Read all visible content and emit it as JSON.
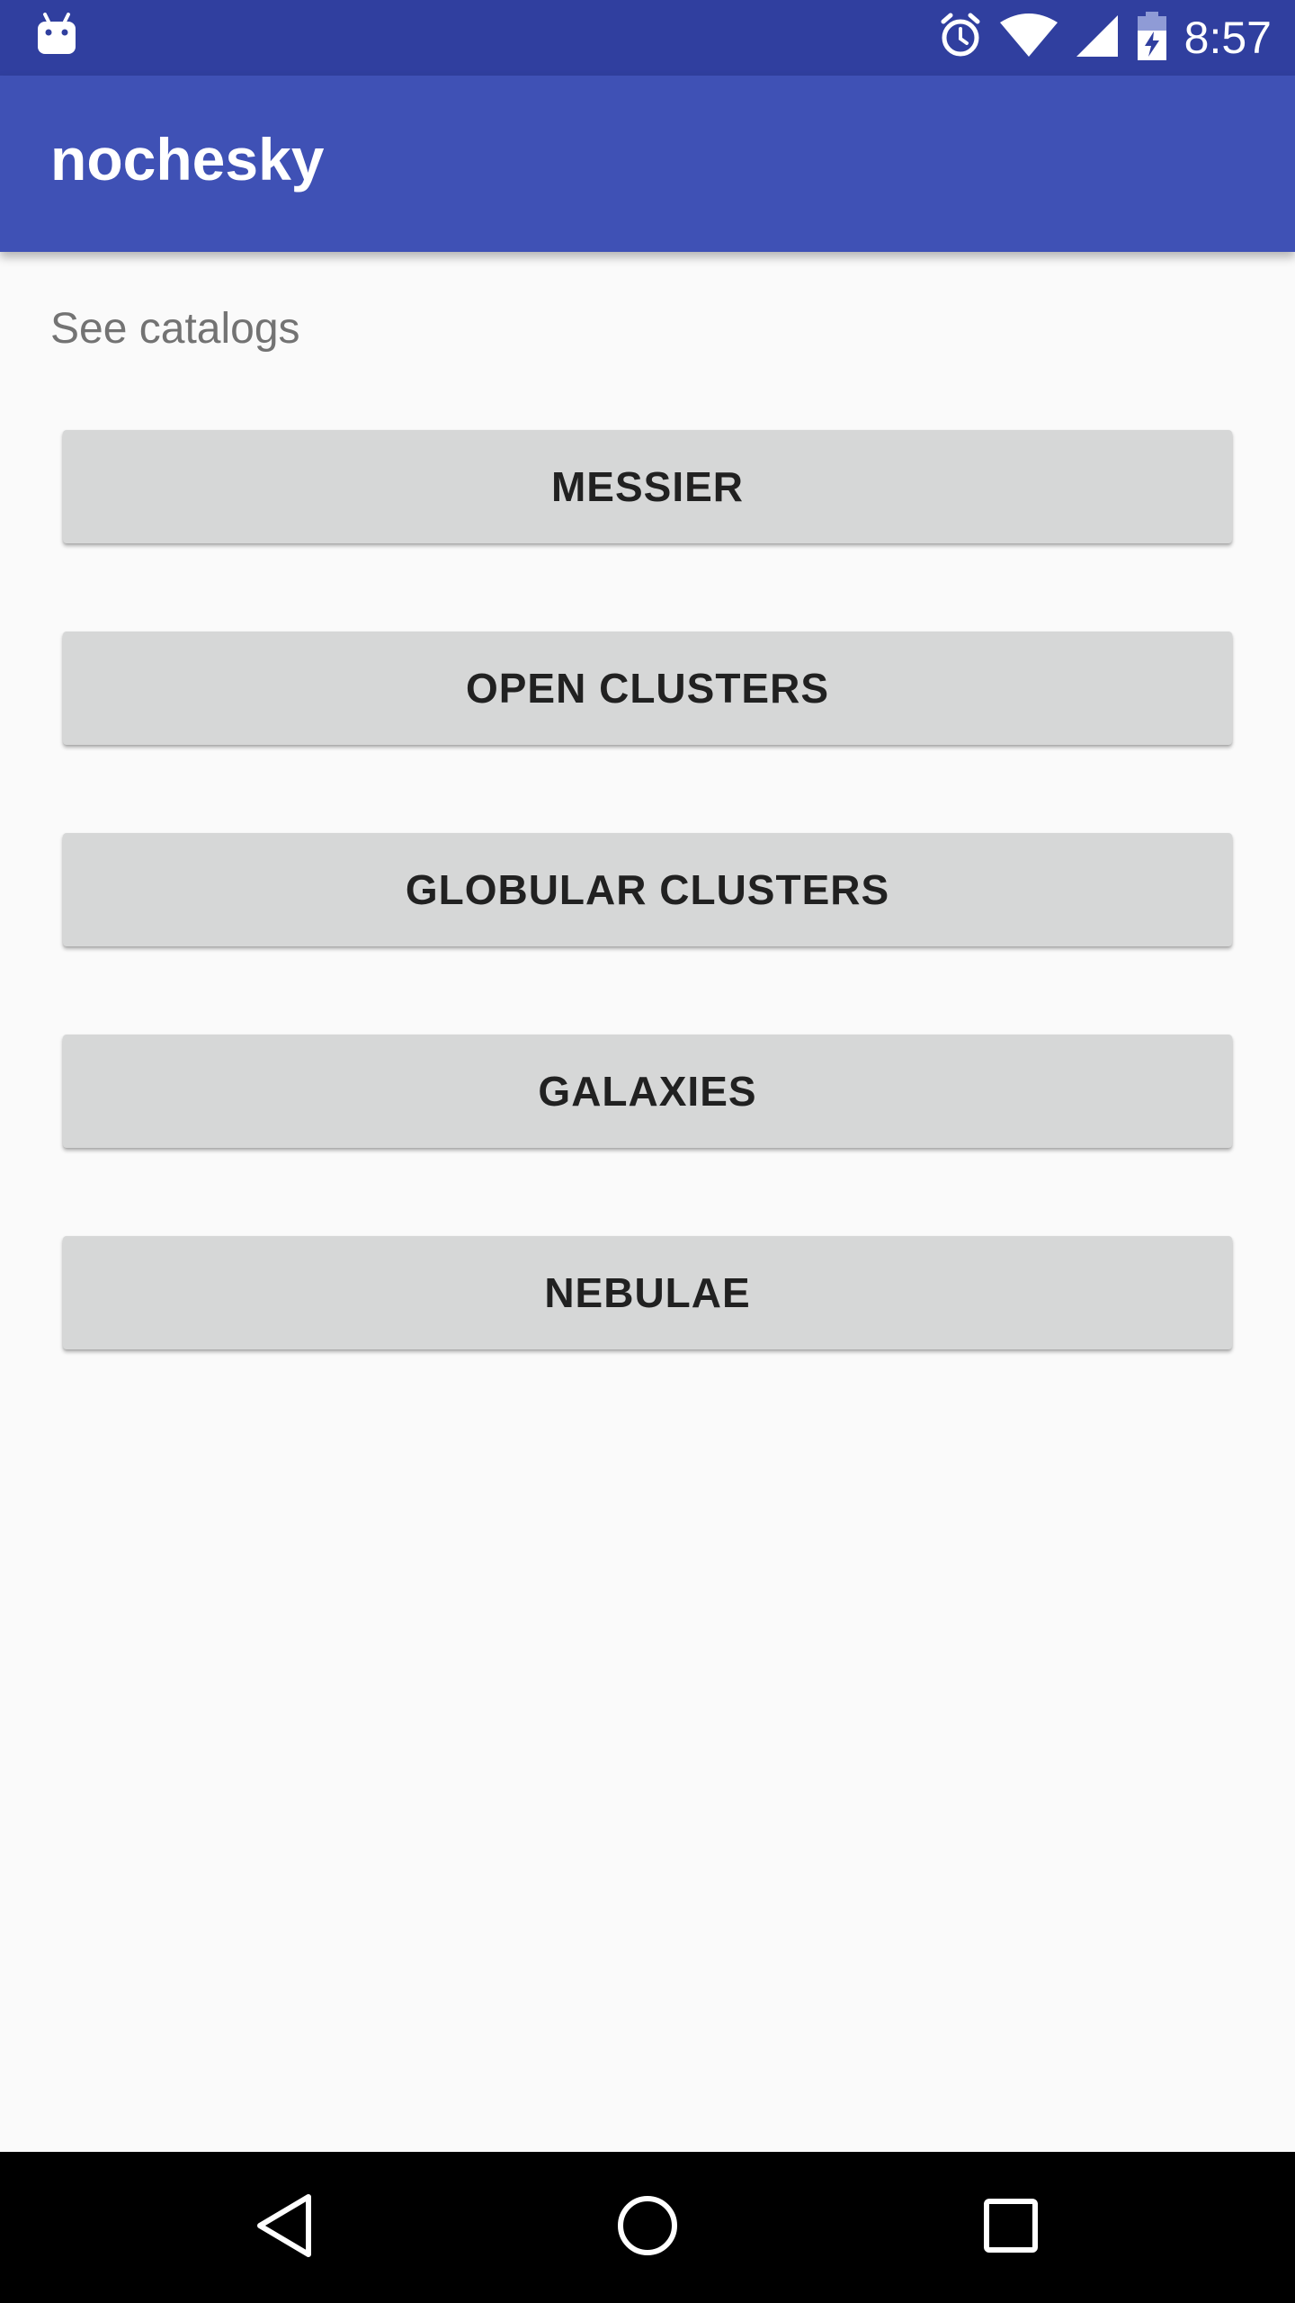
{
  "status_bar": {
    "time": "8:57",
    "icons": [
      "android-notification-icon",
      "alarm-icon",
      "wifi-icon",
      "cell-signal-icon",
      "battery-charging-icon"
    ],
    "background": "#303f9f"
  },
  "app_bar": {
    "title": "nochesky",
    "background": "#3f51b5"
  },
  "main": {
    "section_label": "See catalogs",
    "buttons": [
      {
        "label": "MESSIER"
      },
      {
        "label": "OPEN CLUSTERS"
      },
      {
        "label": "GLOBULAR CLUSTERS"
      },
      {
        "label": "GALAXIES"
      },
      {
        "label": "NEBULAE"
      }
    ]
  },
  "nav_bar": {
    "icons": [
      "back-icon",
      "home-icon",
      "recents-icon"
    ]
  }
}
